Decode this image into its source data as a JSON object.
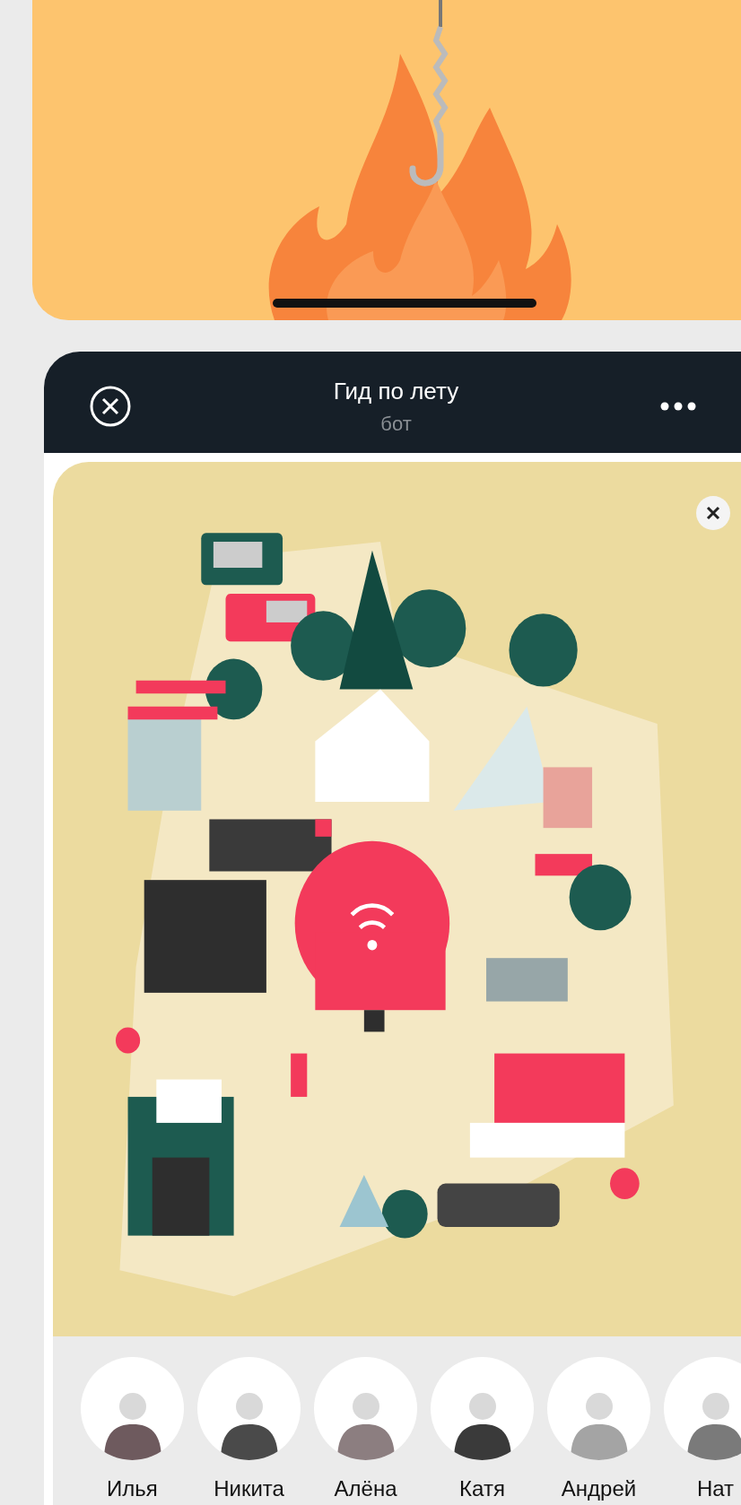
{
  "chat": {
    "title": "Гид по лету",
    "subtitle": "бот"
  },
  "contacts": [
    {
      "name": "Илья"
    },
    {
      "name": "Никита"
    },
    {
      "name": "Алёна"
    },
    {
      "name": "Катя"
    },
    {
      "name": "Андрей"
    },
    {
      "name": "Нат"
    }
  ]
}
